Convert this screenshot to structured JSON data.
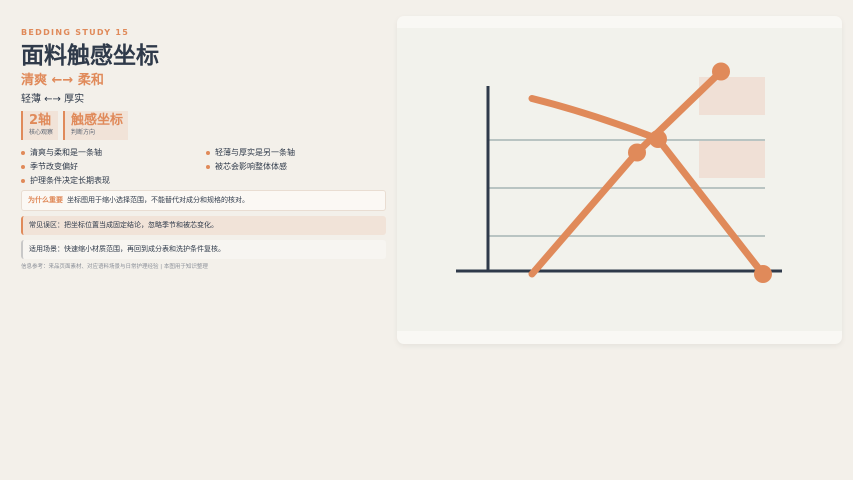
{
  "eyebrow": "BEDDING STUDY 15",
  "title": "面料触感坐标",
  "subtitle": "清爽 ←→ 柔和",
  "axis2": "轻薄 ←→ 厚实",
  "stats": [
    {
      "value": "2轴",
      "label": "核心观察"
    },
    {
      "value": "触感坐标",
      "label": "判断方向"
    }
  ],
  "bullets": [
    "清爽与柔和是一条轴",
    "轻薄与厚实是另一条轴",
    "季节改变偏好",
    "被芯会影响整体体感",
    "护理条件决定长期表现"
  ],
  "why": {
    "key": "为什么重要",
    "text": "坐标图用于缩小选择范围，不能替代对成分和规格的核对。"
  },
  "misconception": "常见误区：把坐标位置当成固定结论，忽略季节和被芯变化。",
  "usage": "适用场景：快速缩小材质范围，再回到成分表和洗护条件复核。",
  "footnote": "信息参考：来品页面素材、对应语料场景与日常护理经验 | 本图用于知识整理",
  "colors": {
    "accent": "#e08a5a",
    "ink": "#2f3a4a",
    "block": "#f0e0d6",
    "grid": "#b9c4c2"
  },
  "chart_data": {
    "type": "line",
    "series": [
      {
        "values": [
          [
            0.25,
            0.85
          ],
          [
            0.55,
            0.7
          ],
          [
            0.8,
            0.2
          ]
        ]
      },
      {
        "values": [
          [
            0.25,
            0.2
          ],
          [
            0.5,
            0.65
          ],
          [
            0.7,
            0.95
          ]
        ]
      }
    ]
  }
}
